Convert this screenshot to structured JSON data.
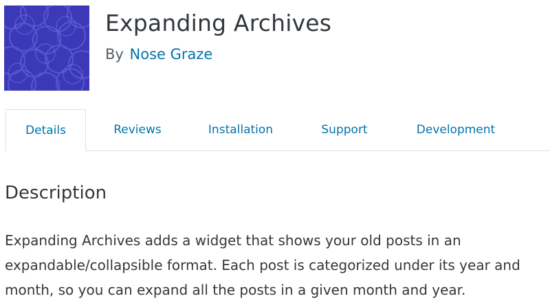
{
  "plugin": {
    "title": "Expanding Archives",
    "by_label": "By",
    "author": "Nose Graze",
    "icon": "plugin-banner-icon",
    "icon_color": "#3b39b8"
  },
  "tabs": [
    {
      "label": "Details",
      "active": true
    },
    {
      "label": "Reviews",
      "active": false
    },
    {
      "label": "Installation",
      "active": false
    },
    {
      "label": "Support",
      "active": false
    },
    {
      "label": "Development",
      "active": false
    }
  ],
  "description": {
    "heading": "Description",
    "body": "Expanding Archives adds a widget that shows your old posts in an expandable/collapsible format. Each post is categorized under its year and month, so you can expand all the posts in a given month and year."
  },
  "colors": {
    "link": "#0073aa",
    "text": "#32373c",
    "border": "#dddddd"
  }
}
